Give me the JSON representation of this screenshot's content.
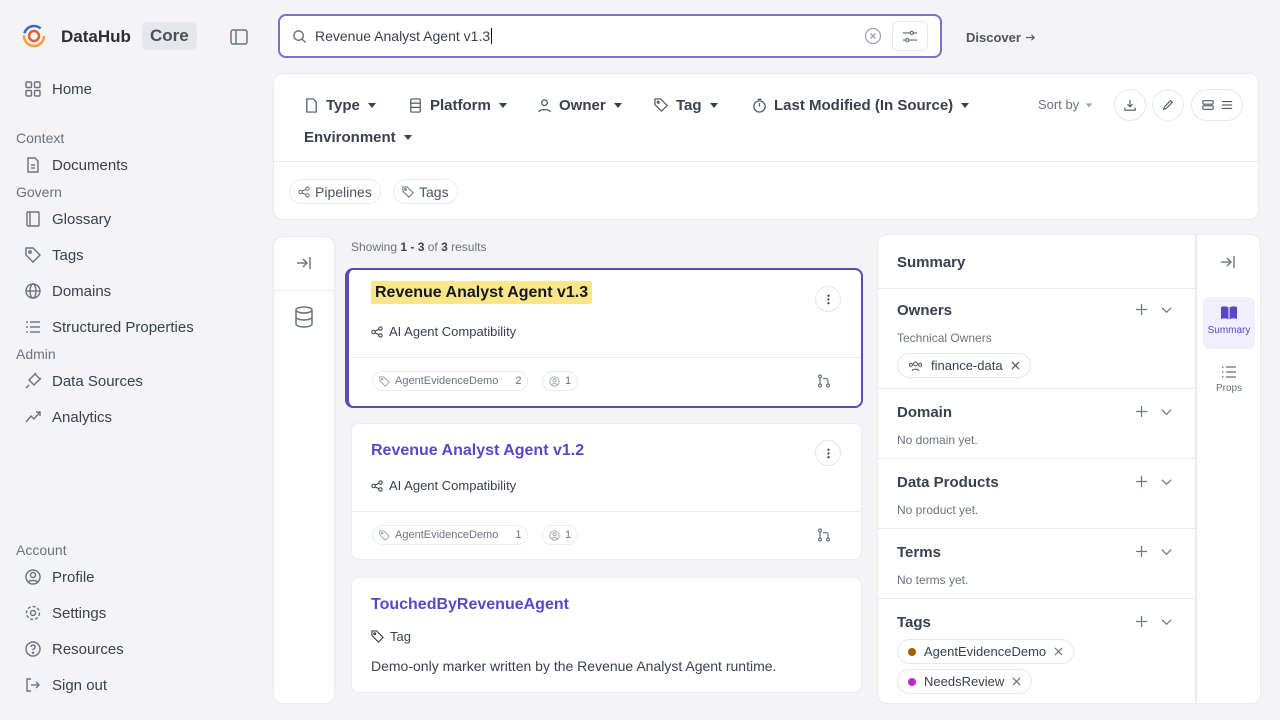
{
  "sidebar": {
    "brand": "DataHub",
    "edition": "Core",
    "home": "Home",
    "sections": {
      "context": "Context",
      "govern": "Govern",
      "admin": "Admin",
      "account": "Account"
    },
    "items": {
      "documents": "Documents",
      "glossary": "Glossary",
      "tags": "Tags",
      "domains": "Domains",
      "structured_properties": "Structured Properties",
      "data_sources": "Data Sources",
      "analytics": "Analytics",
      "profile": "Profile",
      "settings": "Settings",
      "resources": "Resources",
      "sign_out": "Sign out"
    }
  },
  "search": {
    "query": "Revenue Analyst Agent v1.3",
    "discover_label": "Discover"
  },
  "filters": {
    "items": [
      "Type",
      "Platform",
      "Owner",
      "Tag",
      "Last Modified (In Source)",
      "Environment"
    ],
    "sort_label": "Sort by",
    "quick_filters": [
      "Pipelines",
      "Tags"
    ]
  },
  "results": {
    "prefix": "Showing",
    "range": "1 - 3",
    "of": "of",
    "total": "3",
    "suffix": "results",
    "cards": [
      {
        "title": "Revenue Analyst Agent v1.3",
        "type": "AI Agent Compatibility",
        "tag": "AgentEvidenceDemo",
        "tag_count": "2",
        "owner_count": "1"
      },
      {
        "title": "Revenue Analyst Agent v1.2",
        "type": "AI Agent Compatibility",
        "tag": "AgentEvidenceDemo",
        "tag_count": "1",
        "owner_count": "1"
      },
      {
        "title": "TouchedByRevenueAgent",
        "type": "Tag",
        "description": "Demo-only marker written by the Revenue Analyst Agent runtime."
      }
    ]
  },
  "summary": {
    "title": "Summary",
    "owners": {
      "title": "Owners",
      "subtitle": "Technical Owners",
      "pill": "finance-data"
    },
    "domain": {
      "title": "Domain",
      "empty": "No domain yet."
    },
    "data_products": {
      "title": "Data Products",
      "empty": "No product yet."
    },
    "terms": {
      "title": "Terms",
      "empty": "No terms yet."
    },
    "tags": {
      "title": "Tags",
      "items": [
        {
          "label": "AgentEvidenceDemo",
          "color": "#a16207"
        },
        {
          "label": "NeedsReview",
          "color": "#c026d3"
        }
      ]
    },
    "tabs": {
      "summary": "Summary",
      "props": "Props"
    }
  },
  "colors": {
    "accent": "#5a47c7",
    "highlight": "#fde68a"
  }
}
